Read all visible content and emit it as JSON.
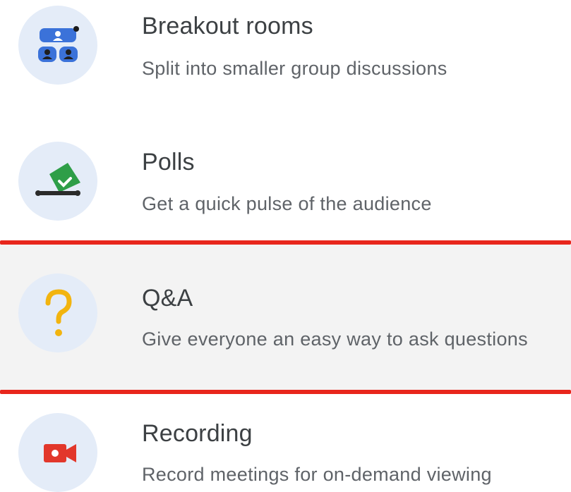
{
  "items": [
    {
      "title": "Breakout rooms",
      "description": "Split into smaller group discussions",
      "icon": "breakout-rooms-icon"
    },
    {
      "title": "Polls",
      "description": "Get a quick pulse of the audience",
      "icon": "polls-icon"
    },
    {
      "title": "Q&A",
      "description": "Give everyone an easy way to ask questions",
      "icon": "question-mark-icon"
    },
    {
      "title": "Recording",
      "description": "Record meetings for on-demand viewing",
      "icon": "recording-camera-icon"
    }
  ],
  "colors": {
    "icon_background": "#e4ecf8",
    "highlight_background": "#f3f3f3",
    "annotation_red": "#e8261c",
    "breakout_blue": "#3b72d9",
    "polls_green": "#2e9e48",
    "qa_yellow": "#f2b40f",
    "recording_red": "#e2372b"
  }
}
